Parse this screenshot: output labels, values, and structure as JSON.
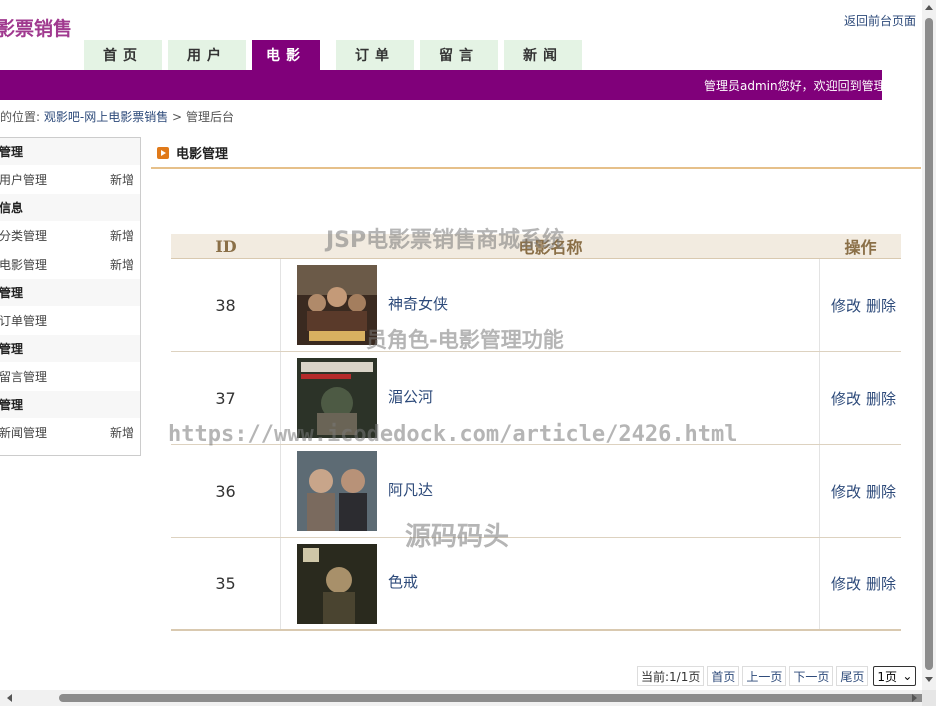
{
  "header": {
    "logo_text": "影票销售",
    "back_link": "返回前台页面",
    "welcome": "管理员admin您好，欢迎回到管理"
  },
  "nav": {
    "tabs": [
      {
        "label": "首页"
      },
      {
        "label": "用户"
      },
      {
        "label": "电影",
        "active": true
      },
      {
        "label": "订单"
      },
      {
        "label": "留言"
      },
      {
        "label": "新闻"
      }
    ]
  },
  "breadcrumb": {
    "prefix": "的位置:",
    "site": "观影吧-网上电影票销售",
    "separator": ">",
    "current": "管理后台"
  },
  "sidebar": {
    "add_label": "新增",
    "groups": [
      {
        "title": "管理",
        "items": [
          {
            "label": "用户管理",
            "has_add": true
          }
        ]
      },
      {
        "title": "信息",
        "items": [
          {
            "label": "分类管理",
            "has_add": true
          },
          {
            "label": "电影管理",
            "has_add": true
          }
        ]
      },
      {
        "title": "管理",
        "items": [
          {
            "label": "订单管理",
            "has_add": false
          }
        ]
      },
      {
        "title": "管理",
        "items": [
          {
            "label": "留言管理",
            "has_add": false
          }
        ]
      },
      {
        "title": "管理",
        "items": [
          {
            "label": "新闻管理",
            "has_add": true
          }
        ]
      }
    ]
  },
  "panel": {
    "title": "电影管理"
  },
  "table": {
    "headers": {
      "id": "ID",
      "name": "电影名称",
      "ops": "操作"
    },
    "edit_label": "修改",
    "delete_label": "删除",
    "rows": [
      {
        "id": "38",
        "name": "神奇女侠",
        "poster": "wonder-woman-poster"
      },
      {
        "id": "37",
        "name": "湄公河",
        "poster": "mekong-poster"
      },
      {
        "id": "36",
        "name": "阿凡达",
        "poster": "avatar-poster"
      },
      {
        "id": "35",
        "name": "色戒",
        "poster": "lust-caution-poster"
      }
    ]
  },
  "pager": {
    "current": "当前:1/1页",
    "first": "首页",
    "prev": "上一页",
    "next": "下一页",
    "last": "尾页",
    "select_value": "1页"
  },
  "watermarks": {
    "line1": "JSP电影票销售商城系统",
    "line2": "员角色-电影管理功能",
    "line3": "https://www.icodedock.com/article/2426.html",
    "line4": "源码码头"
  },
  "colors": {
    "brand_purple": "#80007a",
    "nav_tab_bg": "#e4f3e4",
    "link_blue": "#2d4a7a",
    "table_header_bg": "#f2ebe0",
    "accent_orange": "#e07a1a"
  }
}
